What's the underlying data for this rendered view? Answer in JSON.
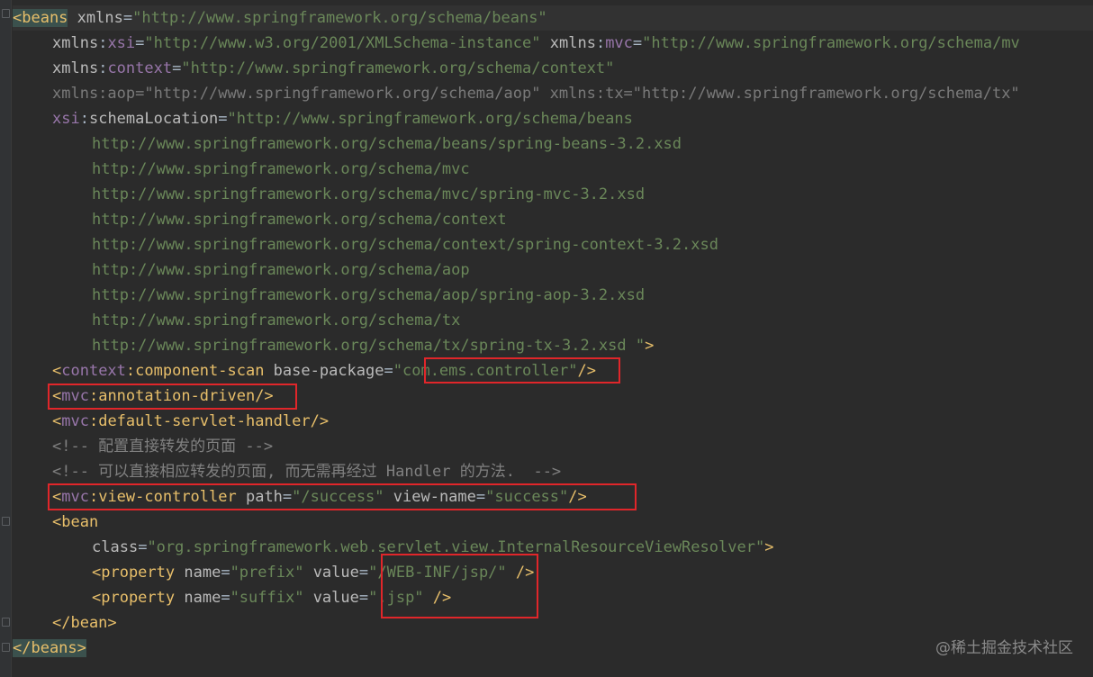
{
  "editor": {
    "lines": [
      {
        "segments": [
          [
            "hl-tag",
            "<beans"
          ],
          [
            "attr",
            " xmlns"
          ],
          [
            "plain",
            "="
          ],
          [
            "val",
            "\"http://www.springframework.org/schema/beans\""
          ]
        ]
      },
      {
        "segments": [
          [
            "attr",
            "xmlns"
          ],
          [
            "plain",
            ":"
          ],
          [
            "ns",
            "xsi"
          ],
          [
            "plain",
            "="
          ],
          [
            "val",
            "\"http://www.w3.org/2001/XMLSchema-instance\""
          ],
          [
            "attr",
            " xmlns"
          ],
          [
            "plain",
            ":"
          ],
          [
            "ns",
            "mvc"
          ],
          [
            "plain",
            "="
          ],
          [
            "val",
            "\"http://www.springframework.org/schema/mv"
          ]
        ]
      },
      {
        "segments": [
          [
            "attr",
            "xmlns"
          ],
          [
            "plain",
            ":"
          ],
          [
            "ns",
            "context"
          ],
          [
            "plain",
            "="
          ],
          [
            "val",
            "\"http://www.springframework.org/schema/context\""
          ]
        ]
      },
      {
        "segments": [
          [
            "attr dim",
            "xmlns:aop=\"http://www.springframework.org/schema/aop\" xmlns:tx=\"http://www.springframework.org/schema/tx\""
          ]
        ]
      },
      {
        "segments": [
          [
            "ns",
            "xsi"
          ],
          [
            "plain",
            ":"
          ],
          [
            "attr",
            "schemaLocation"
          ],
          [
            "plain",
            "="
          ],
          [
            "val",
            "\"http://www.springframework.org/schema/beans"
          ]
        ]
      },
      {
        "segments": [
          [
            "val",
            "http://www.springframework.org/schema/beans/spring-beans-3.2.xsd"
          ]
        ]
      },
      {
        "segments": [
          [
            "val",
            "http://www.springframework.org/schema/mvc"
          ]
        ]
      },
      {
        "segments": [
          [
            "val",
            "http://www.springframework.org/schema/mvc/spring-mvc-3.2.xsd"
          ]
        ]
      },
      {
        "segments": [
          [
            "val",
            "http://www.springframework.org/schema/context"
          ]
        ]
      },
      {
        "segments": [
          [
            "val",
            "http://www.springframework.org/schema/context/spring-context-3.2.xsd"
          ]
        ]
      },
      {
        "segments": [
          [
            "val",
            "http://www.springframework.org/schema/aop"
          ]
        ]
      },
      {
        "segments": [
          [
            "val",
            "http://www.springframework.org/schema/aop/spring-aop-3.2.xsd"
          ]
        ]
      },
      {
        "segments": [
          [
            "val",
            "http://www.springframework.org/schema/tx"
          ]
        ]
      },
      {
        "segments": [
          [
            "val",
            "http://www.springframework.org/schema/tx/spring-tx-3.2.xsd \""
          ],
          [
            "tag",
            ">"
          ]
        ]
      },
      {
        "segments": [
          [
            "tag",
            "<"
          ],
          [
            "ns",
            "context"
          ],
          [
            "tag",
            ":component-scan"
          ],
          [
            "attr",
            " base-package"
          ],
          [
            "plain",
            "="
          ],
          [
            "val",
            "\"com.ems.controller\""
          ],
          [
            "tag",
            "/>"
          ]
        ]
      },
      {
        "segments": [
          [
            "tag",
            "<"
          ],
          [
            "ns",
            "mvc"
          ],
          [
            "tag",
            ":annotation-driven/>"
          ]
        ]
      },
      {
        "segments": [
          [
            "tag",
            "<"
          ],
          [
            "ns",
            "mvc"
          ],
          [
            "tag",
            ":default-servlet-handler/>"
          ]
        ]
      },
      {
        "segments": [
          [
            "cmt",
            "<!-- 配置直接转发的页面 -->"
          ]
        ]
      },
      {
        "segments": [
          [
            "cmt",
            "<!-- 可以直接相应转发的页面, 而无需再经过 Handler 的方法.  -->"
          ]
        ]
      },
      {
        "segments": [
          [
            "tag",
            "<"
          ],
          [
            "ns",
            "mvc"
          ],
          [
            "tag",
            ":view-controller"
          ],
          [
            "attr",
            " path"
          ],
          [
            "plain",
            "="
          ],
          [
            "val",
            "\"/success\""
          ],
          [
            "attr",
            " view-name"
          ],
          [
            "plain",
            "="
          ],
          [
            "val",
            "\"success\""
          ],
          [
            "tag",
            "/>"
          ]
        ]
      },
      {
        "segments": [
          [
            "tag",
            "<bean"
          ]
        ]
      },
      {
        "segments": [
          [
            "attr",
            "class"
          ],
          [
            "plain",
            "="
          ],
          [
            "val",
            "\"org.springframework.web.servlet.view.InternalResourceViewResolver\""
          ],
          [
            "tag",
            ">"
          ]
        ]
      },
      {
        "segments": [
          [
            "tag",
            "<property"
          ],
          [
            "attr",
            " name"
          ],
          [
            "plain",
            "="
          ],
          [
            "val",
            "\"prefix\""
          ],
          [
            "attr",
            " value"
          ],
          [
            "plain",
            "="
          ],
          [
            "val",
            "\"/WEB-INF/jsp/\""
          ],
          [
            "tag",
            " />"
          ]
        ]
      },
      {
        "segments": [
          [
            "tag",
            "<property"
          ],
          [
            "attr",
            " name"
          ],
          [
            "plain",
            "="
          ],
          [
            "val",
            "\"suffix\""
          ],
          [
            "attr",
            " value"
          ],
          [
            "plain",
            "="
          ],
          [
            "val",
            "\".jsp\""
          ],
          [
            "tag",
            " />"
          ]
        ]
      },
      {
        "segments": [
          [
            "tag",
            "</bean>"
          ]
        ]
      },
      {
        "segments": [
          [
            "hl-tag",
            "</beans>"
          ]
        ]
      }
    ]
  },
  "watermark": "@稀土掘金技术社区"
}
